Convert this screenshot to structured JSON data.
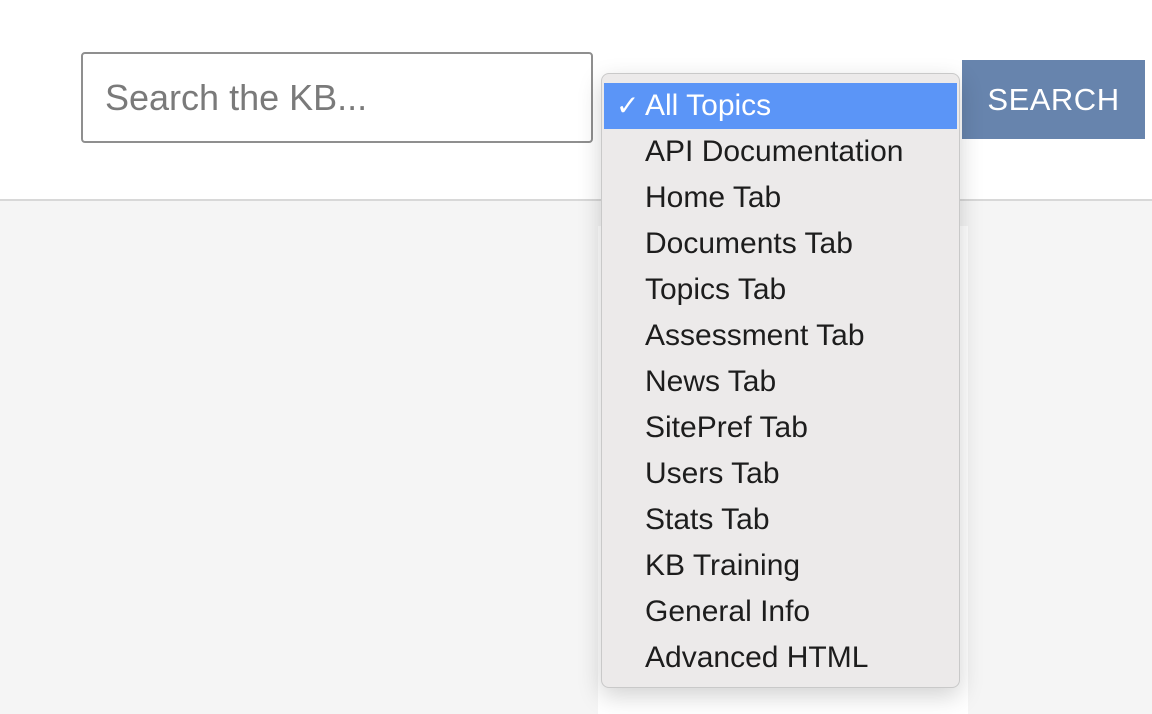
{
  "search": {
    "placeholder": "Search the KB...",
    "button_label": "SEARCH"
  },
  "topics_select": {
    "selected": "All Topics",
    "options": [
      "All Topics",
      "API Documentation",
      "Home Tab",
      "Documents Tab",
      "Topics Tab",
      "Assessment Tab",
      "News Tab",
      "SitePref Tab",
      "Users Tab",
      "Stats Tab",
      "KB Training",
      "General Info",
      "Advanced HTML"
    ],
    "check_icon": "✓"
  },
  "colors": {
    "accent_button": "#6784ad",
    "selected_option": "#5b95f7"
  }
}
